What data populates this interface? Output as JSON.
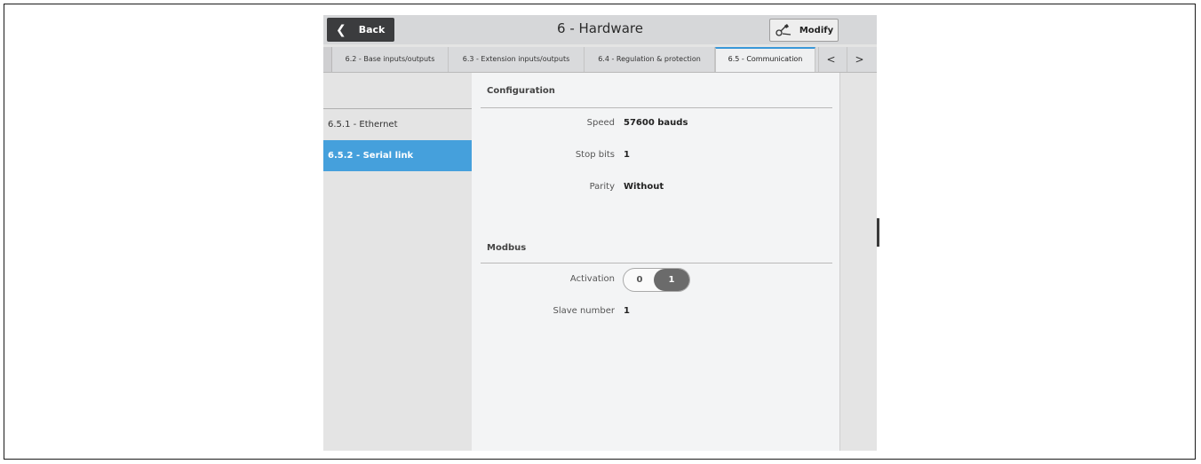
{
  "header": {
    "back_label": "Back",
    "title": "6 - Hardware",
    "modify_label": "Modify"
  },
  "tabs": [
    {
      "label": "6.2 - Base inputs/outputs"
    },
    {
      "label": "6.3 - Extension inputs/outputs"
    },
    {
      "label": "6.4 - Regulation & protection"
    },
    {
      "label": "6.5 - Communication",
      "active": true
    }
  ],
  "tab_nav": {
    "prev": "<",
    "next": ">"
  },
  "sidebar": {
    "items": [
      {
        "label": "6.5.1 - Ethernet"
      },
      {
        "label": "6.5.2 - Serial link",
        "selected": true
      }
    ]
  },
  "configuration": {
    "title": "Configuration",
    "speed_label": "Speed",
    "speed_value": "57600 bauds",
    "stopbits_label": "Stop bits",
    "stopbits_value": "1",
    "parity_label": "Parity",
    "parity_value": "Without"
  },
  "modbus": {
    "title": "Modbus",
    "activation_label": "Activation",
    "activation_off": "0",
    "activation_on": "1",
    "slave_label": "Slave number",
    "slave_value": "1"
  },
  "colors": {
    "accent": "#45a0dc",
    "dark_button": "#3b3c3e",
    "toggle_active": "#6b6b6b"
  }
}
